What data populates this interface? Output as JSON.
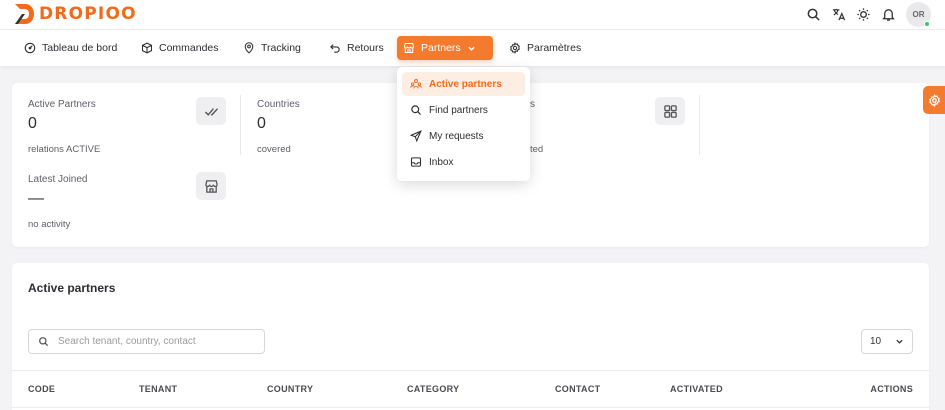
{
  "brand": {
    "name": "DROPIOO",
    "color": "#f26a1b"
  },
  "header": {
    "icons": [
      "search-icon",
      "translate-icon",
      "sun-icon",
      "bell-icon"
    ],
    "avatar_initials": "OR"
  },
  "nav": {
    "items": [
      {
        "label": "Tableau de bord",
        "icon": "dashboard-icon"
      },
      {
        "label": "Commandes",
        "icon": "box-icon"
      },
      {
        "label": "Tracking",
        "icon": "map-pin-icon"
      },
      {
        "label": "Retours",
        "icon": "return-arrow-icon"
      },
      {
        "label": "Partners",
        "icon": "store-icon",
        "active": true
      },
      {
        "label": "Paramètres",
        "icon": "gear-icon"
      }
    ]
  },
  "partners_menu": {
    "items": [
      {
        "label": "Active partners",
        "icon": "users-icon",
        "active": true
      },
      {
        "label": "Find partners",
        "icon": "search-icon"
      },
      {
        "label": "My requests",
        "icon": "send-icon"
      },
      {
        "label": "Inbox",
        "icon": "inbox-icon"
      }
    ]
  },
  "stats": {
    "active_partners": {
      "label": "Active Partners",
      "value": "0",
      "sub": "relations ACTIVE"
    },
    "countries": {
      "label": "Countries",
      "value": "0",
      "sub": "covered"
    },
    "third": {
      "label": "s",
      "value": "",
      "sub": "ted"
    },
    "latest_joined": {
      "label": "Latest Joined",
      "value": "—",
      "sub": "no activity"
    }
  },
  "table": {
    "title": "Active partners",
    "search_placeholder": "Search tenant, country, contact",
    "page_size": "10",
    "columns": [
      "CODE",
      "TENANT",
      "COUNTRY",
      "CATEGORY",
      "CONTACT",
      "ACTIVATED",
      "ACTIONS"
    ]
  },
  "colors": {
    "accent": "#f47a2e",
    "accent_soft": "#fdeee3"
  }
}
